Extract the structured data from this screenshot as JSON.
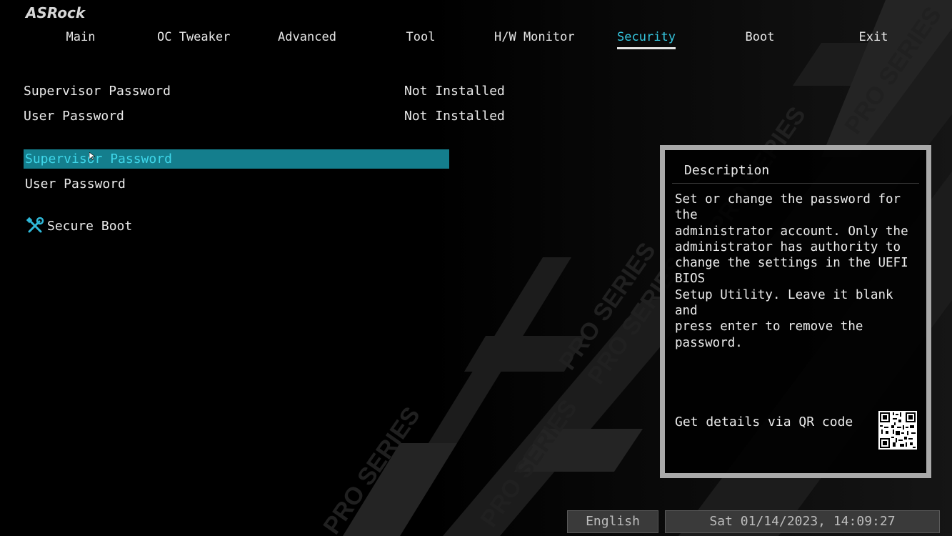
{
  "brand": {
    "logo_text": "ASRock"
  },
  "tabs": [
    {
      "label": "Main"
    },
    {
      "label": "OC Tweaker"
    },
    {
      "label": "Advanced"
    },
    {
      "label": "Tool"
    },
    {
      "label": "H/W Monitor"
    },
    {
      "label": "Security",
      "active": true
    },
    {
      "label": "Boot"
    },
    {
      "label": "Exit"
    }
  ],
  "status": [
    {
      "label": "Supervisor Password",
      "value": "Not Installed"
    },
    {
      "label": "User Password",
      "value": "Not Installed"
    }
  ],
  "menu": [
    {
      "label": "Supervisor Password",
      "selected": true
    },
    {
      "label": "User Password",
      "selected": false
    }
  ],
  "submenu": {
    "label": "Secure Boot",
    "icon": "tools-icon"
  },
  "description": {
    "title": "Description",
    "text": "Set or change the password for the\nadministrator account. Only the\nadministrator has authority to\nchange the settings in the UEFI BIOS\nSetup Utility. Leave it blank and\npress enter to remove the password.",
    "qr_label": "Get details via QR code"
  },
  "footer": {
    "language": "English",
    "datetime": "Sat 01/14/2023, 14:09:27"
  },
  "colors": {
    "accent": "#36c7e0",
    "selection_bg": "#147e8d",
    "panel_border": "#a9a9a9"
  }
}
